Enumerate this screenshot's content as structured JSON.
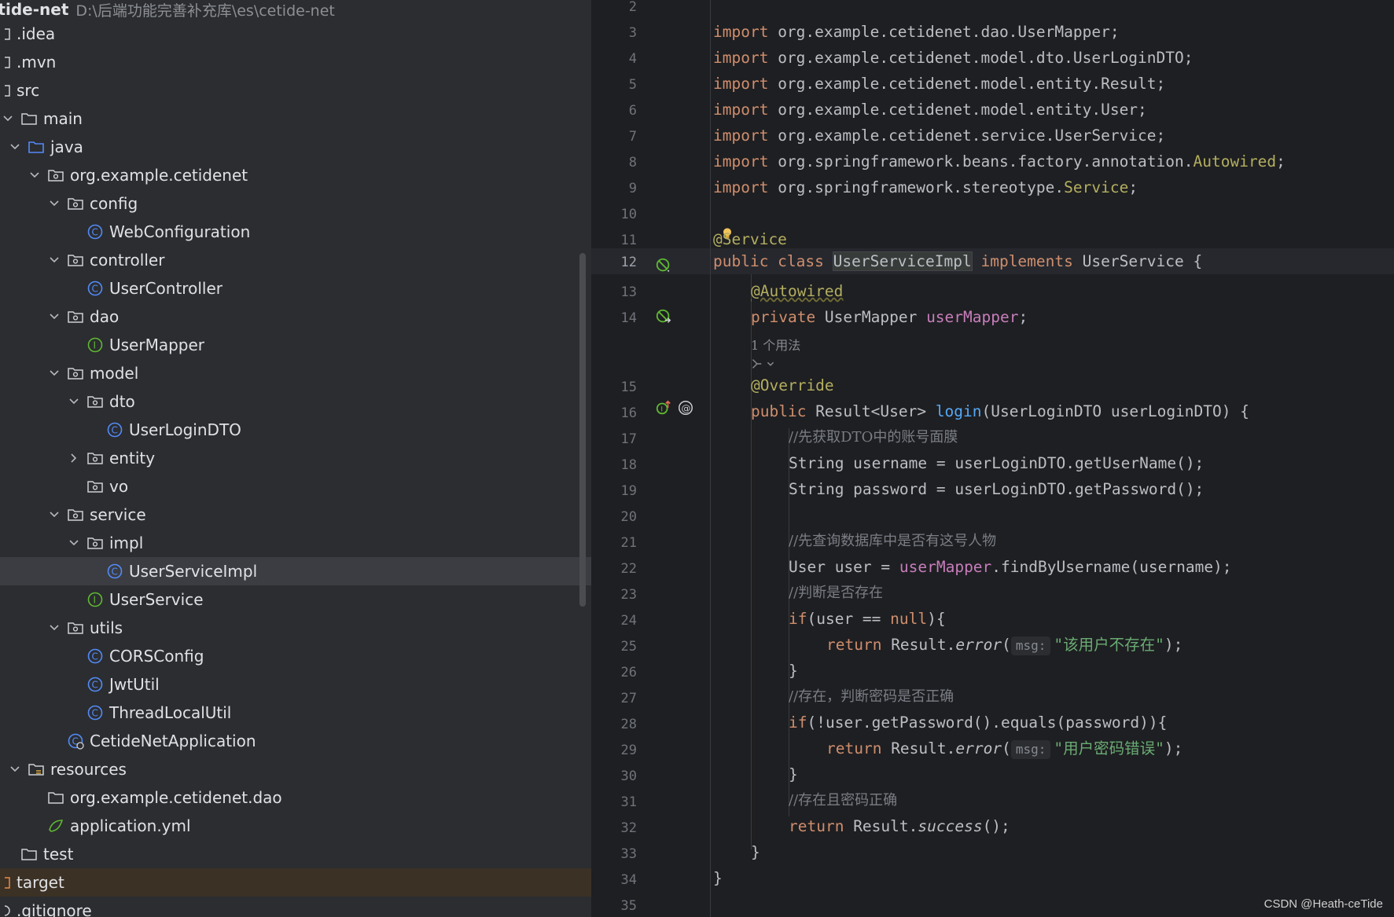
{
  "project": {
    "root_name": "cetide-net",
    "root_path": "D:\\后端功能完善补充库\\es\\cetide-net",
    "items": [
      {
        "label": ".idea",
        "kind": "folder-plain"
      },
      {
        "label": ".mvn",
        "kind": "folder-plain"
      },
      {
        "label": "src",
        "kind": "folder-plain"
      },
      {
        "label": "main",
        "kind": "folder"
      },
      {
        "label": "java",
        "kind": "source-folder"
      },
      {
        "label": "org.example.cetidenet",
        "kind": "package"
      },
      {
        "label": "config",
        "kind": "package"
      },
      {
        "label": "WebConfiguration",
        "kind": "class"
      },
      {
        "label": "controller",
        "kind": "package"
      },
      {
        "label": "UserController",
        "kind": "class"
      },
      {
        "label": "dao",
        "kind": "package"
      },
      {
        "label": "UserMapper",
        "kind": "interface"
      },
      {
        "label": "model",
        "kind": "package"
      },
      {
        "label": "dto",
        "kind": "package"
      },
      {
        "label": "UserLoginDTO",
        "kind": "class"
      },
      {
        "label": "entity",
        "kind": "package"
      },
      {
        "label": "vo",
        "kind": "package"
      },
      {
        "label": "service",
        "kind": "package"
      },
      {
        "label": "impl",
        "kind": "package"
      },
      {
        "label": "UserServiceImpl",
        "kind": "class"
      },
      {
        "label": "UserService",
        "kind": "interface"
      },
      {
        "label": "utils",
        "kind": "package"
      },
      {
        "label": "CORSConfig",
        "kind": "class"
      },
      {
        "label": "JwtUtil",
        "kind": "class"
      },
      {
        "label": "ThreadLocalUtil",
        "kind": "class"
      },
      {
        "label": "CetideNetApplication",
        "kind": "spring-app"
      },
      {
        "label": "resources",
        "kind": "resources-folder"
      },
      {
        "label": "org.example.cetidenet.dao",
        "kind": "folder"
      },
      {
        "label": "application.yml",
        "kind": "yaml"
      },
      {
        "label": "test",
        "kind": "folder"
      },
      {
        "label": "target",
        "kind": "excluded"
      },
      {
        "label": ".gitignore",
        "kind": "file"
      }
    ]
  },
  "editor": {
    "line_numbers": [
      "2",
      "3",
      "4",
      "5",
      "6",
      "7",
      "8",
      "9",
      "10",
      "11",
      "12",
      "13",
      "14",
      "15",
      "16",
      "17",
      "18",
      "19",
      "20",
      "21",
      "22",
      "23",
      "24",
      "25",
      "26",
      "27",
      "28",
      "29",
      "30",
      "31",
      "32",
      "33",
      "34",
      "35"
    ],
    "code": {
      "l3": "import org.example.cetidenet.dao.UserMapper;",
      "l4": "import org.example.cetidenet.model.dto.UserLoginDTO;",
      "l5": "import org.example.cetidenet.model.entity.Result;",
      "l6": "import org.example.cetidenet.model.entity.User;",
      "l7": "import org.example.cetidenet.service.UserService;",
      "l8_a": "import org.springframework.beans.factory.annotation.",
      "l8_b": "Autowired",
      "l8_c": ";",
      "l9_a": "import org.springframework.stereotype.",
      "l9_b": "Service",
      "l9_c": ";",
      "l11": "@Service",
      "l12_a": "public class ",
      "l12_b": "UserServiceImpl",
      "l12_c": " implements ",
      "l12_d": "UserService {",
      "l13": "@Autowired",
      "l14_a": "private ",
      "l14_b": "UserMapper ",
      "l14_c": "userMapper",
      "l14_d": ";",
      "usage": "1 个用法",
      "l15": "@Override",
      "l16_a": "public ",
      "l16_b": "Result<User> ",
      "l16_c": "login",
      "l16_d": "(UserLoginDTO userLoginDTO) {",
      "l17": "//先获取DTO中的账号面膜",
      "l18": "String username = userLoginDTO.getUserName();",
      "l19": "String password = userLoginDTO.getPassword();",
      "l21": "//先查询数据库中是否有这号人物",
      "l22_a": "User user = ",
      "l22_b": "userMapper",
      "l22_c": ".findByUsername(username);",
      "l23": "//判断是否存在",
      "l24_a": "if",
      "l24_b": "(user == ",
      "l24_c": "null",
      "l24_d": "){",
      "l25_a": "return ",
      "l25_b": "Result.",
      "l25_c": "error",
      "l25_d": "(",
      "l25_hint": "msg:",
      "l25_e": "\"该用户不存在\"",
      "l25_f": ");",
      "l26": "}",
      "l27": "//存在，判断密码是否正确",
      "l28_a": "if",
      "l28_b": "(!user.getPassword().equals(password)){",
      "l29_a": "return ",
      "l29_b": "Result.",
      "l29_c": "error",
      "l29_d": "(",
      "l29_hint": "msg:",
      "l29_e": "\"用户密码错误\"",
      "l29_f": ");",
      "l30": "}",
      "l31": "//存在且密码正确",
      "l32_a": "return ",
      "l32_b": "Result.",
      "l32_c": "success",
      "l32_d": "();",
      "l33": "}",
      "l34": "}"
    }
  },
  "watermark": "CSDN @Heath-ceTide",
  "colors": {
    "keyword": "#cf8e6d",
    "annotation": "#b3ae60",
    "method": "#56a8f5",
    "field": "#c77dbb",
    "string": "#6aab73",
    "comment": "#7a7e85"
  }
}
